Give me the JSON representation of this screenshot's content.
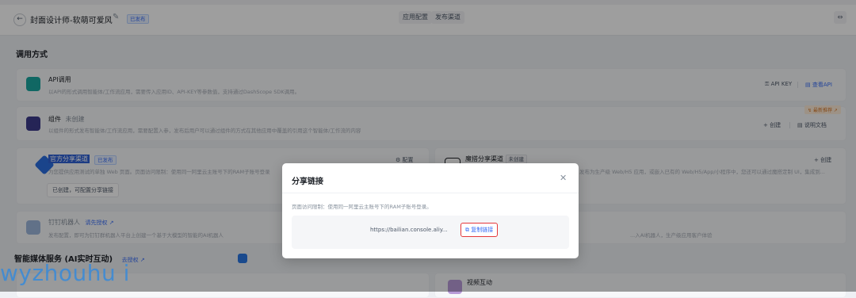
{
  "header": {
    "title": "封面设计师-软萌可爱风",
    "status_badge": "已发布",
    "tab_app_config": "应用配置",
    "tab_publish_channel": "发布渠道"
  },
  "section_invoke": {
    "title": "调用方式"
  },
  "api_card": {
    "title": "API调用",
    "desc": "以API的形式调用智能体/工作流应用，需要传入应用ID、API-KEY等参数值，支持通过DashScope SDK调用。",
    "api_key_label": "API KEY",
    "view_api_label": "查看API"
  },
  "component_card": {
    "title": "组件",
    "status": "未创建",
    "desc": "以组件的形式发布智能体/工作流应用，需要配置入参，发布后用户可以通过组件的方式在其他应用中覆盖的引用这个智能体/工作流的内容",
    "hot_badge": "最新推荐",
    "create_label": "创建",
    "docs_label": "说明文档"
  },
  "official_share_card": {
    "title": "官方分享渠道",
    "status_badge": "已发布",
    "desc": "为您提供应用测试的单独 Web 页面。页面访问限制：使用同一阿里云主账号下的RAM子账号登录",
    "config_label": "配置",
    "status_pill": "已创建，可配置分享链接"
  },
  "moda_share_card": {
    "title": "魔搭分享渠道",
    "status": "未创建",
    "desc": "发布为生产级 Web/H5 应用，或嵌入已有的 Web/H5/App/小程序中，您还可以通过魔搭定制 UI，集成到...",
    "create_label": "创建"
  },
  "dingtalk_card": {
    "title": "钉钉机器人",
    "auth_link": "请先授权",
    "desc": "发布配置，即可为钉钉群机器人平台上创建一个基于大模型的智能的AI机器人",
    "desc_right": "...入AI机器人，生产级应用客户体验"
  },
  "section_media": {
    "title": "智能媒体服务 (AI实时互动)",
    "auth_link": "去授权"
  },
  "video_card": {
    "title": "视频互动"
  },
  "modal": {
    "title": "分享链接",
    "desc": "页面访问限制：使用同一阿里云主账号下的RAM子账号登录。",
    "url": "https://bailian.console.aliy...",
    "copy_label": "复制链接"
  },
  "watermark": {
    "text": "wyzhouhu i"
  },
  "colors": {
    "accent": "#3a6ff7",
    "highlight": "#e5383b",
    "overlay": "rgba(0,0,0,0.38)"
  },
  "icons": [
    "back-arrow-icon",
    "edit-pencil-icon",
    "expand-icon",
    "key-icon",
    "doc-icon",
    "plus-icon",
    "gear-icon",
    "close-icon",
    "copy-icon",
    "external-link-icon"
  ]
}
